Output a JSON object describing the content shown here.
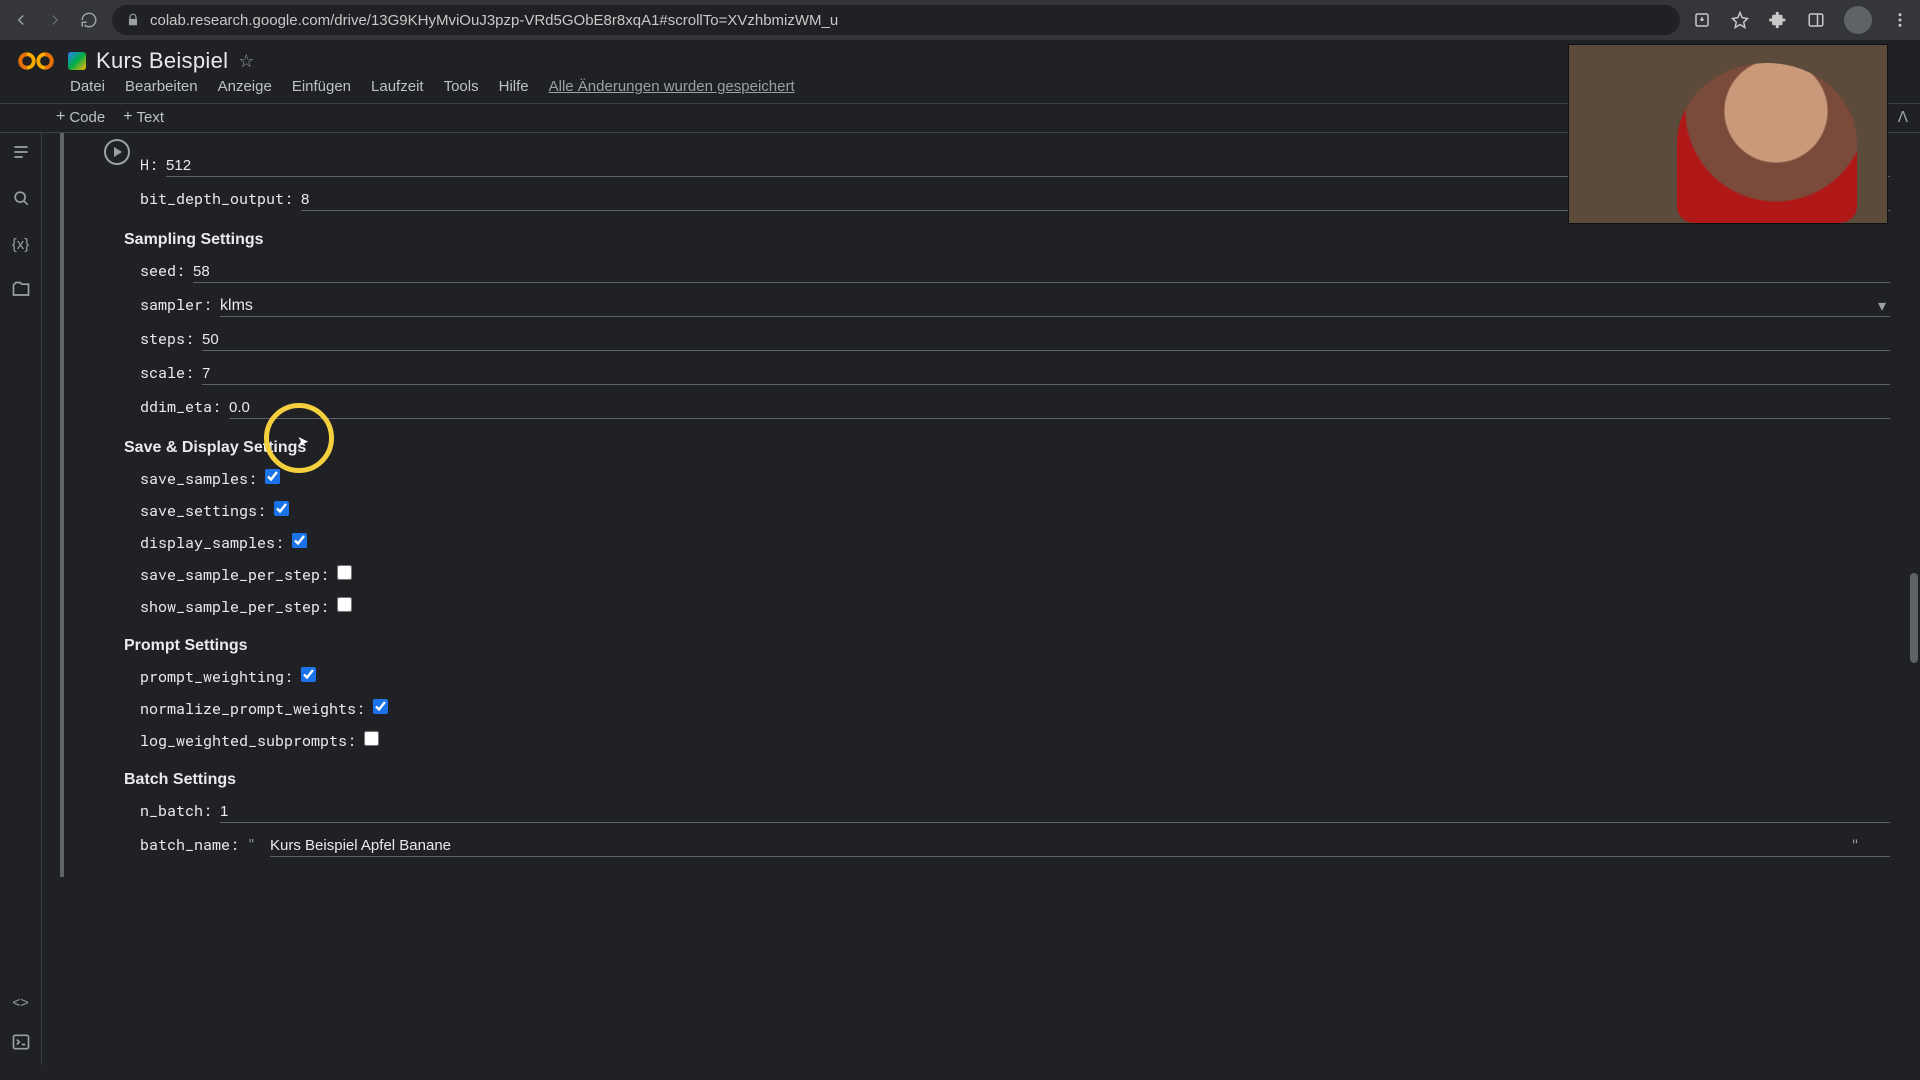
{
  "browser": {
    "url": "colab.research.google.com/drive/13G9KHyMviOuJ3pzp-VRd5GObE8r8xqA1#scrollTo=XVzhbmizWM_u"
  },
  "doc": {
    "title": "Kurs Beispiel"
  },
  "menu": {
    "file": "Datei",
    "edit": "Bearbeiten",
    "view": "Anzeige",
    "insert": "Einfügen",
    "runtime": "Laufzeit",
    "tools": "Tools",
    "help": "Hilfe",
    "saved": "Alle Änderungen wurden gespeichert"
  },
  "toolbar": {
    "code": "Code",
    "text": "Text"
  },
  "sections": {
    "sampling": "Sampling Settings",
    "save_display": "Save & Display Settings",
    "prompt": "Prompt Settings",
    "batch": "Batch Settings"
  },
  "fields": {
    "h": {
      "label": "H:",
      "value": "512"
    },
    "bit_depth_output": {
      "label": "bit_depth_output:",
      "value": "8"
    },
    "seed": {
      "label": "seed:",
      "value": "58"
    },
    "sampler": {
      "label": "sampler:",
      "value": "klms"
    },
    "steps": {
      "label": "steps:",
      "value": "50"
    },
    "scale": {
      "label": "scale:",
      "value": "7"
    },
    "ddim_eta": {
      "label": "ddim_eta:",
      "value": "0.0"
    },
    "save_samples": {
      "label": "save_samples:"
    },
    "save_settings": {
      "label": "save_settings:"
    },
    "display_samples": {
      "label": "display_samples:"
    },
    "save_sample_per_step": {
      "label": "save_sample_per_step:"
    },
    "show_sample_per_step": {
      "label": "show_sample_per_step:"
    },
    "prompt_weighting": {
      "label": "prompt_weighting:"
    },
    "normalize_prompt_weights": {
      "label": "normalize_prompt_weights:"
    },
    "log_weighted_subprompts": {
      "label": "log_weighted_subprompts:"
    },
    "n_batch": {
      "label": "n_batch:",
      "value": "1"
    },
    "batch_name": {
      "label": "batch_name:",
      "value": "Kurs Beispiel Apfel Banane"
    }
  }
}
